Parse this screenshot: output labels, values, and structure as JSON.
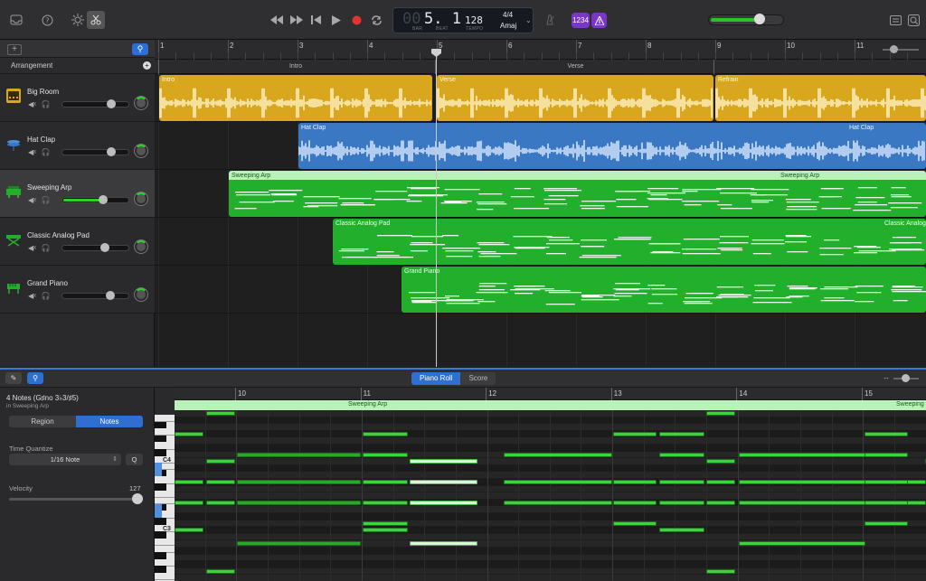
{
  "colors": {
    "accent": "#2e6fd1",
    "audio_yellow": "#d8a71d",
    "audio_blue": "#3b78c4",
    "midi_green": "#22b02c",
    "purple": "#7a36c6"
  },
  "toolbar": {
    "left_icons": [
      "inbox-icon",
      "help-icon",
      "settings-icon",
      "scissors-icon"
    ],
    "transport": [
      "rewind-icon",
      "fast-forward-icon",
      "go-to-start-icon",
      "play-icon",
      "record-icon",
      "cycle-icon"
    ],
    "lcd": {
      "position": "5. 1",
      "position_dim": "00",
      "bar_label": "BAR",
      "beat_label": "BEAT",
      "tempo": "128",
      "tempo_label": "TEMPO",
      "time_signature": "4/4",
      "key": "Amaj"
    },
    "count_in": "1234",
    "metronome_icon": "metronome-icon",
    "right_icons": [
      "list-icon",
      "search-icon"
    ],
    "master_volume": 0.67
  },
  "tracks_header": {
    "arrangement_label": "Arrangement"
  },
  "tracks": [
    {
      "name": "Big Room",
      "icon": "drum-machine-icon",
      "color": "#d8a71d",
      "volume": 0.72
    },
    {
      "name": "Hat Clap",
      "icon": "hi-hat-icon",
      "color": "#3b78c4",
      "volume": 0.72
    },
    {
      "name": "Sweeping Arp",
      "icon": "synth-icon",
      "color": "#22b02c",
      "volume": 0.6
    },
    {
      "name": "Classic Analog Pad",
      "icon": "keyboard-stand-icon",
      "color": "#22b02c",
      "volume": 0.62
    },
    {
      "name": "Grand Piano",
      "icon": "piano-icon",
      "color": "#22b02c",
      "volume": 0.7
    }
  ],
  "ruler": {
    "bars": [
      "1",
      "2",
      "3",
      "4",
      "5",
      "6",
      "7",
      "8",
      "9",
      "10",
      "11"
    ]
  },
  "markers": [
    {
      "label": "Intro"
    },
    {
      "label": "Verse"
    }
  ],
  "regions": {
    "big_room": [
      {
        "label": "Intro"
      },
      {
        "label": "Verse"
      },
      {
        "label": "Refrain"
      }
    ],
    "hat_clap": {
      "label": "Hat Clap",
      "label2": "Hat Clap"
    },
    "sweeping_arp": {
      "label": "Sweeping Arp",
      "label2": "Sweeping Arp"
    },
    "classic_pad": {
      "label": "Classic Analog Pad",
      "label2": "Classic Analog Pad"
    },
    "grand_piano": {
      "label": "Grand Piano"
    }
  },
  "editor": {
    "tabs": [
      "Piano Roll",
      "Score"
    ],
    "selection_title": "4 Notes (G♯no 3♭3/♯5)",
    "selection_sub": "in Sweeping Arp",
    "segments": [
      "Region",
      "Notes"
    ],
    "time_quantize_label": "Time Quantize",
    "time_quantize_value": "1/16 Note",
    "quantize_button": "Q",
    "velocity_label": "Velocity",
    "velocity_value": "127",
    "ruler_bars": [
      "10",
      "11",
      "12",
      "13",
      "14",
      "15"
    ],
    "region_label": "Sweeping Arp",
    "region_label2": "Sweeping",
    "key_labels": [
      "C4",
      "C3"
    ]
  }
}
